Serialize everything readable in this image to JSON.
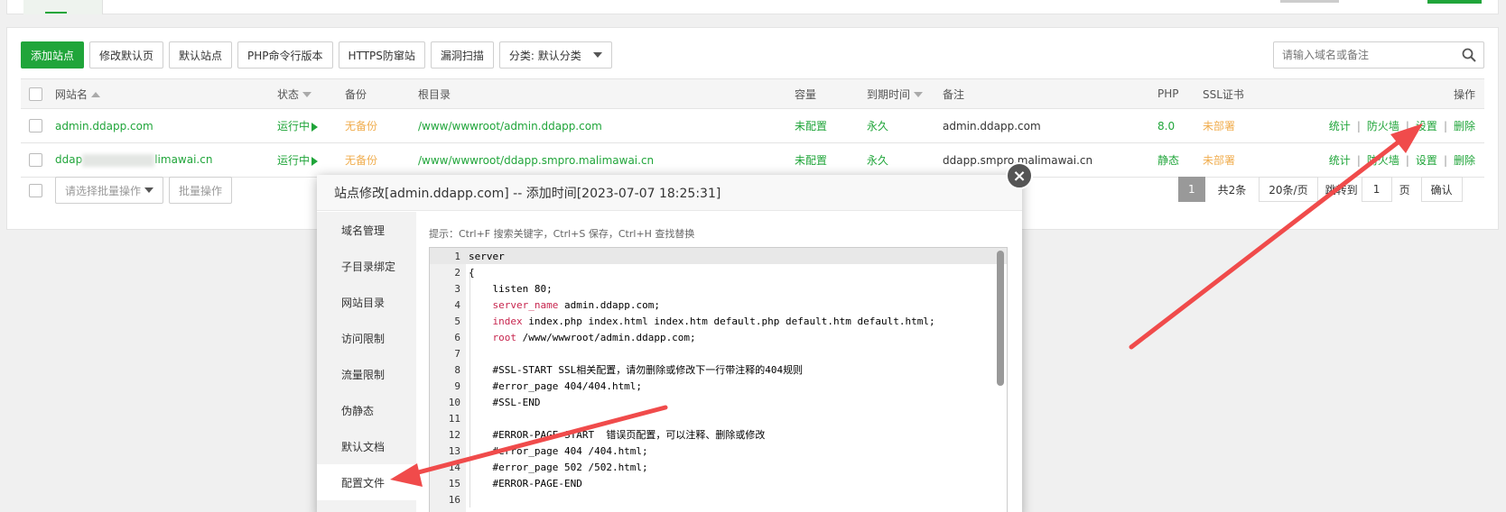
{
  "toolbar": {
    "buttons": [
      "添加站点",
      "修改默认页",
      "默认站点",
      "PHP命令行版本",
      "HTTPS防窜站",
      "漏洞扫描"
    ],
    "category_select": "分类: 默认分类"
  },
  "search": {
    "placeholder": "请输入域名或备注"
  },
  "table": {
    "headers": [
      "网站名",
      "状态",
      "备份",
      "根目录",
      "容量",
      "到期时间",
      "备注",
      "PHP",
      "SSL证书",
      "操作"
    ],
    "rows": [
      {
        "name": "admin.ddapp.com",
        "status": "运行中",
        "backup": "无备份",
        "root": "/www/wwwroot/admin.ddapp.com",
        "capacity": "未配置",
        "expire": "永久",
        "note": "admin.ddapp.com",
        "php": "8.0",
        "ssl": "未部署",
        "ops": [
          "统计",
          "防火墙",
          "设置",
          "删除"
        ]
      },
      {
        "name_prefix": "ddap",
        "name_suffix": "limawai.cn",
        "status": "运行中",
        "backup": "无备份",
        "root": "/www/wwwroot/ddapp.smpro.malimawai.cn",
        "capacity": "未配置",
        "expire": "永久",
        "note": "ddapp.smpro.malimawai.cn",
        "php": "静态",
        "ssl": "未部署",
        "ops": [
          "统计",
          "防火墙",
          "设置",
          "删除"
        ]
      }
    ]
  },
  "bottom": {
    "batch_select": "请选择批量操作",
    "batch_button": "批量操作"
  },
  "pager": {
    "current": "1",
    "total": "共2条",
    "per_page": "20条/页",
    "jump_label": "跳转到",
    "jump_value": "1",
    "page_unit": "页",
    "confirm": "确认"
  },
  "dialog": {
    "title": "站点修改[admin.ddapp.com] -- 添加时间[2023-07-07 18:25:31]",
    "close": "×",
    "menu": [
      "域名管理",
      "子目录绑定",
      "网站目录",
      "访问限制",
      "流量限制",
      "伪静态",
      "默认文档",
      "配置文件"
    ],
    "active_menu": "配置文件",
    "tip": "提示：Ctrl+F 搜索关键字，Ctrl+S 保存，Ctrl+H 查找替换",
    "code_lines": [
      {
        "n": "1",
        "text": "server"
      },
      {
        "n": "2",
        "text": "{"
      },
      {
        "n": "3",
        "text": "    listen 80;"
      },
      {
        "n": "4",
        "text": "    server_name admin.ddapp.com;"
      },
      {
        "n": "5",
        "text": "    index index.php index.html index.htm default.php default.htm default.html;"
      },
      {
        "n": "6",
        "text": "    root /www/wwwroot/admin.ddapp.com;"
      },
      {
        "n": "7",
        "text": ""
      },
      {
        "n": "8",
        "text": "    #SSL-START SSL相关配置，请勿删除或修改下一行带注释的404规则"
      },
      {
        "n": "9",
        "text": "    #error_page 404/404.html;"
      },
      {
        "n": "10",
        "text": "    #SSL-END"
      },
      {
        "n": "11",
        "text": ""
      },
      {
        "n": "12",
        "text": "    #ERROR-PAGE-START  错误页配置，可以注释、删除或修改"
      },
      {
        "n": "13",
        "text": "    #error_page 404 /404.html;"
      },
      {
        "n": "14",
        "text": "    #error_page 502 /502.html;"
      },
      {
        "n": "15",
        "text": "    #ERROR-PAGE-END"
      },
      {
        "n": "16",
        "text": ""
      }
    ]
  },
  "colors": {
    "accent": "#20a53a",
    "warning": "#f0ad4e",
    "arrow": "#f04b4b"
  }
}
